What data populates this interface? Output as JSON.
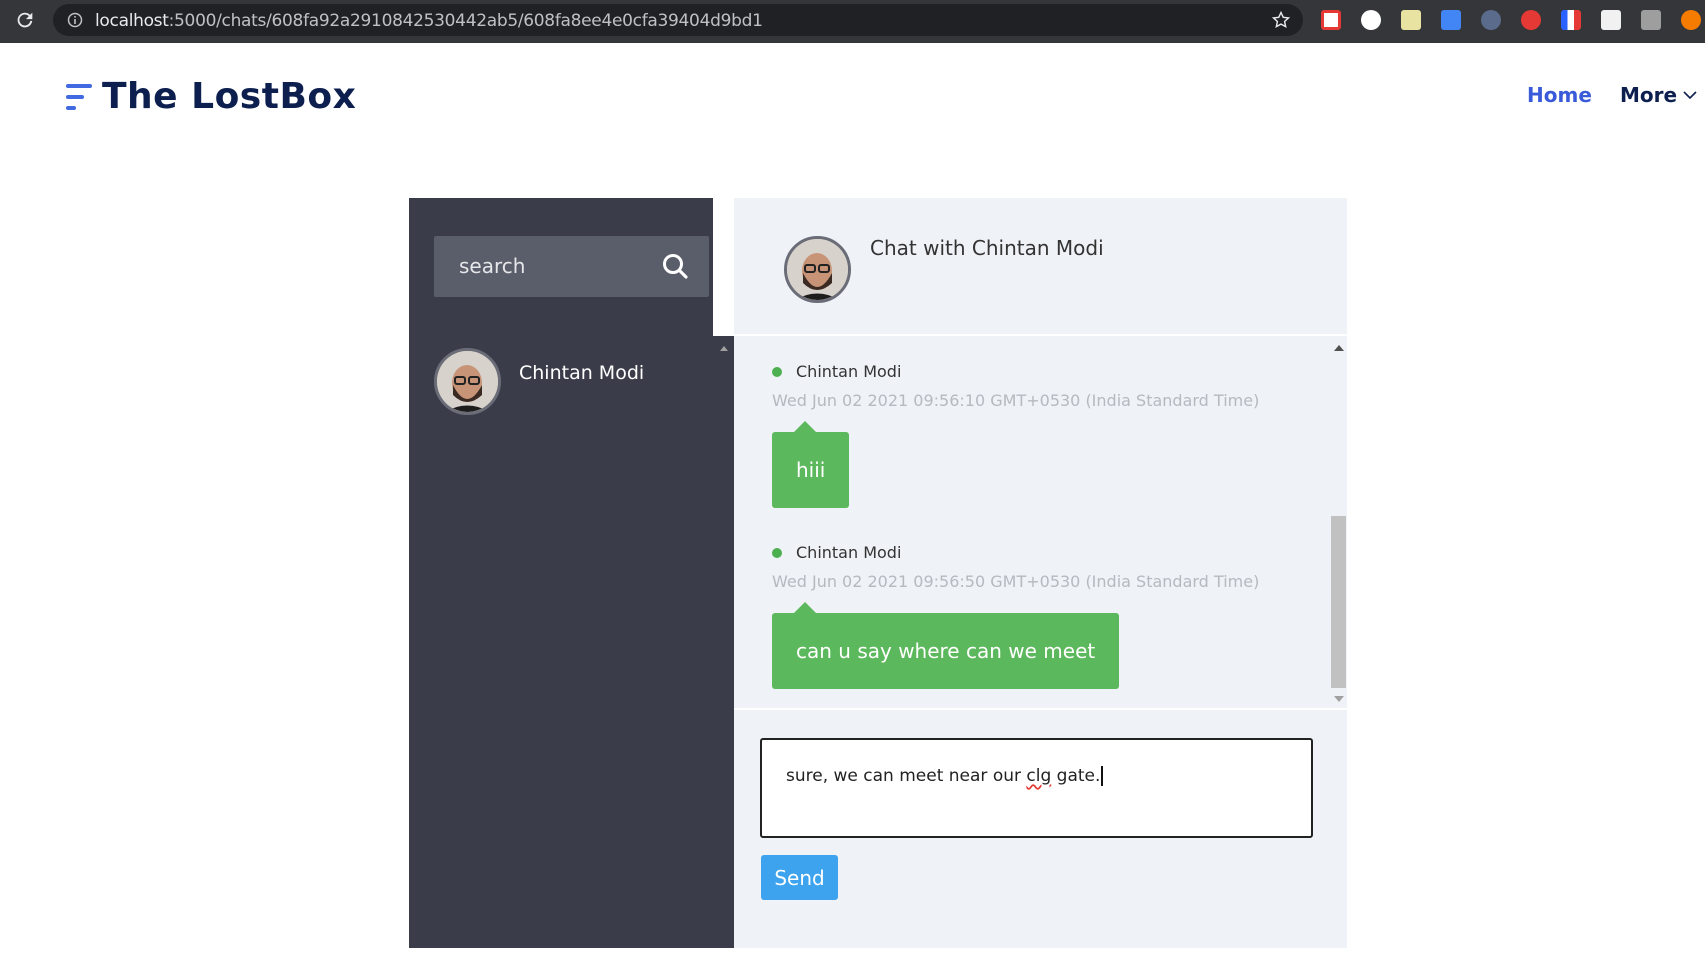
{
  "browser": {
    "url_host": "localhost",
    "url_path": ":5000/chats/608fa92a2910842530442ab5/608fa8ee4e0cfa39404d9bd1"
  },
  "site": {
    "logo_text": "The LostBox",
    "nav": {
      "home": "Home",
      "more": "More"
    }
  },
  "sidebar": {
    "search_placeholder": "search",
    "contacts": [
      {
        "name": "Chintan Modi"
      }
    ]
  },
  "chat": {
    "title": "Chat with Chintan Modi",
    "messages": [
      {
        "sender": "Chintan Modi",
        "time": "Wed Jun 02 2021 09:56:10 GMT+0530 (India Standard Time)",
        "text": "hiii"
      },
      {
        "sender": "Chintan Modi",
        "time": "Wed Jun 02 2021 09:56:50 GMT+0530 (India Standard Time)",
        "text": "can u say where can we meet"
      }
    ],
    "composer": {
      "before": "sure, we can meet near our ",
      "misspelled": "clg",
      "after": " gate."
    },
    "send_label": "Send"
  },
  "colors": {
    "sidebar_bg": "#3a3d49",
    "chat_bg": "#eff2f7",
    "bubble": "#5cb85c",
    "send": "#3ea3ee",
    "brand": "#0d1f4f",
    "accent": "#3a5bd9"
  }
}
